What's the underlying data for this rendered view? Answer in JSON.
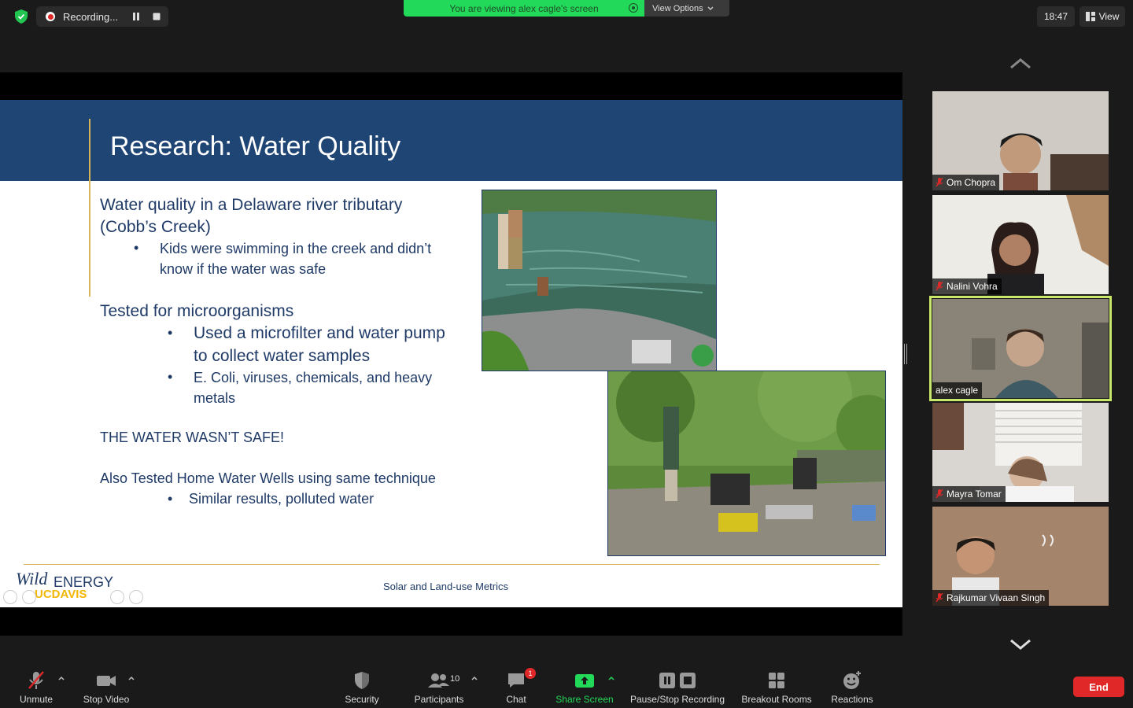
{
  "topbar": {
    "recording_label": "Recording...",
    "viewing_banner": "You are viewing alex cagle's screen",
    "view_options_label": "View Options",
    "clock": "18:47",
    "view_label": "View"
  },
  "slide": {
    "title": "Research: Water Quality",
    "p1_line1": "Water quality in a Delaware river tributary",
    "p1_line2": "(Cobb’s Creek)",
    "p1_b1_line1": "Kids were swimming in the creek and didn’t",
    "p1_b1_line2": "know if the water was safe",
    "p2": "Tested for microorganisms",
    "p2_b1_line1": "Used a microfilter and water pump",
    "p2_b1_line2": "to collect water samples",
    "p2_b2_line1": "E. Coli, viruses, chemicals, and heavy",
    "p2_b2_line2": "metals",
    "p3": "THE WATER WASN’T SAFE!",
    "p4": "Also Tested Home Water Wells using same technique",
    "p4_b1": "Similar results, polluted water",
    "bullet": "•",
    "footer": "Solar and Land-use Metrics",
    "logo_wild": "Wild",
    "logo_energy": "ENERGY",
    "logo_ucd": "UCDAVIS"
  },
  "participants": [
    {
      "name": "Om Chopra",
      "muted": true
    },
    {
      "name": "Nalini Vohra",
      "muted": true
    },
    {
      "name": "alex cagle",
      "muted": false
    },
    {
      "name": "Mayra Tomar",
      "muted": true
    },
    {
      "name": "Rajkumar Vivaan Singh",
      "muted": true
    }
  ],
  "toolbar": {
    "unmute": "Unmute",
    "stop_video": "Stop Video",
    "security": "Security",
    "participants": "Participants",
    "participants_count": "10",
    "chat": "Chat",
    "chat_badge": "1",
    "share_screen": "Share Screen",
    "pause_stop_recording": "Pause/Stop Recording",
    "breakout_rooms": "Breakout Rooms",
    "reactions": "Reactions",
    "end": "End"
  },
  "colors": {
    "slide_header": "#1f4574",
    "slide_text": "#1f3a66",
    "gold": "#d6b656",
    "active_speaker": "#c9e86a",
    "share_green": "#23d959",
    "end_red": "#e02828"
  }
}
